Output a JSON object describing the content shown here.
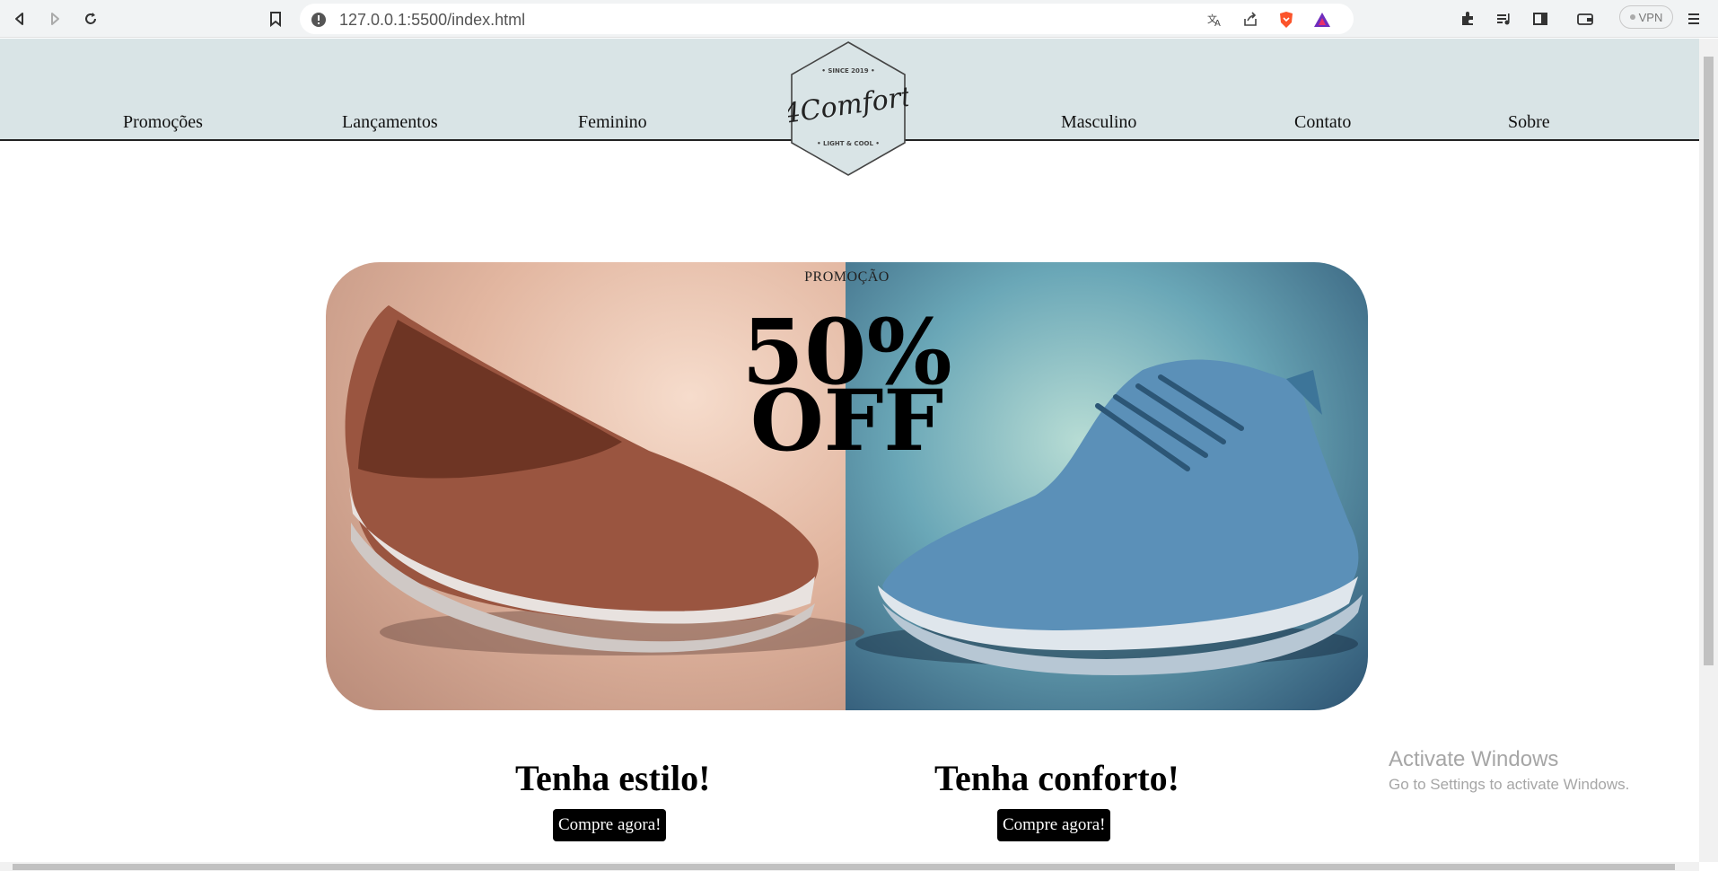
{
  "browser": {
    "url": "127.0.0.1:5500/index.html",
    "vpn_label": "VPN"
  },
  "nav": {
    "left": [
      "Promoções",
      "Lançamentos",
      "Feminino"
    ],
    "right": [
      "Masculino",
      "Contato",
      "Sobre"
    ]
  },
  "logo": {
    "since": "• SINCE 2019 •",
    "name": "4Comfort",
    "tagline": "• LIGHT & COOL •"
  },
  "banner": {
    "label": "PROMOÇÃO",
    "percent": "50%",
    "off": "OFF"
  },
  "cta": [
    {
      "title": "Tenha estilo!",
      "button": "Compre agora!"
    },
    {
      "title": "Tenha conforto!",
      "button": "Compre agora!"
    }
  ],
  "watermark": {
    "line1": "Activate Windows",
    "line2": "Go to Settings to activate Windows."
  },
  "colors": {
    "header_bg": "#d9e4e6",
    "button_bg": "#000000"
  }
}
